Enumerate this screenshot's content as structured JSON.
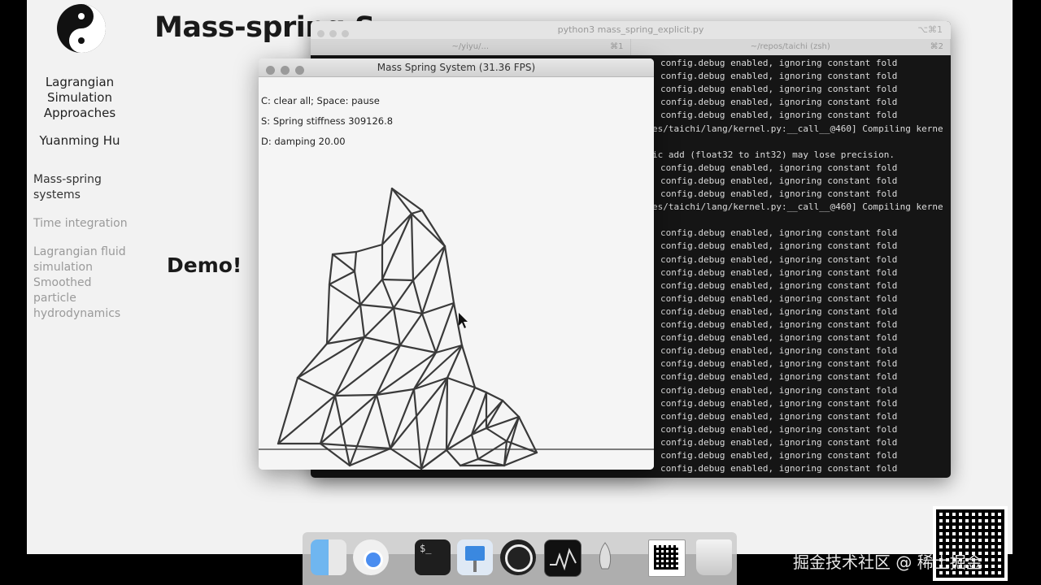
{
  "slide": {
    "title": "Mass-spring S",
    "sidebar_title_lines": [
      "Lagrangian",
      "Simulation",
      "Approaches"
    ],
    "author": "Yuanming Hu",
    "nav": [
      {
        "label_lines": [
          "Mass-spring",
          "systems"
        ],
        "active": true
      },
      {
        "label_lines": [
          "Time integration"
        ],
        "active": false
      },
      {
        "label_lines": [
          "Lagrangian fluid",
          "simulation"
        ],
        "active": false
      },
      {
        "label_lines": [
          "Smoothed",
          "particle",
          "hydrodynamics"
        ],
        "active": false
      }
    ],
    "demo": "Demo!"
  },
  "terminal": {
    "title": "python3 mass_spring_explicit.py",
    "shortcut": "⌥⌘1",
    "tabs": [
      {
        "label": "~/yiyu/...",
        "key": "⌘1"
      },
      {
        "label": "~/repos/taichi (zsh)",
        "key": "⌘2"
      }
    ],
    "lines": [
      "config.debug enabled, ignoring constant fold",
      "config.debug enabled, ignoring constant fold",
      "config.debug enabled, ignoring constant fold",
      "config.debug enabled, ignoring constant fold",
      "config.debug enabled, ignoring constant fold",
      "es/taichi/lang/kernel.py:__call__@460] Compiling kerne",
      "",
      "ic add (float32 to int32) may lose precision.",
      "config.debug enabled, ignoring constant fold",
      "config.debug enabled, ignoring constant fold",
      "config.debug enabled, ignoring constant fold",
      "es/taichi/lang/kernel.py:__call__@460] Compiling kerne",
      "",
      "config.debug enabled, ignoring constant fold",
      "config.debug enabled, ignoring constant fold",
      "config.debug enabled, ignoring constant fold",
      "config.debug enabled, ignoring constant fold",
      "config.debug enabled, ignoring constant fold",
      "config.debug enabled, ignoring constant fold",
      "config.debug enabled, ignoring constant fold",
      "config.debug enabled, ignoring constant fold",
      "config.debug enabled, ignoring constant fold",
      "config.debug enabled, ignoring constant fold",
      "config.debug enabled, ignoring constant fold",
      "config.debug enabled, ignoring constant fold",
      "config.debug enabled, ignoring constant fold",
      "config.debug enabled, ignoring constant fold",
      "config.debug enabled, ignoring constant fold",
      "config.debug enabled, ignoring constant fold",
      "config.debug enabled, ignoring constant fold",
      "config.debug enabled, ignoring constant fold",
      "config.debug enabled, ignoring constant fold"
    ]
  },
  "mass_spring_window": {
    "title": "Mass Spring System (31.36 FPS)",
    "help_lines": [
      "C: clear all; Space: pause",
      "S: Spring stiffness 309126.8",
      "D: damping 20.00"
    ]
  },
  "dock": {
    "apps": [
      "finder-icon",
      "chrome-icon",
      "terminal-icon",
      "keynote-icon",
      "obs-icon",
      "activity-monitor-icon",
      "launchpad-icon",
      "qr-icon",
      "trash-icon"
    ]
  },
  "watermark": "掘金技术社区 @ 稀土掘金"
}
